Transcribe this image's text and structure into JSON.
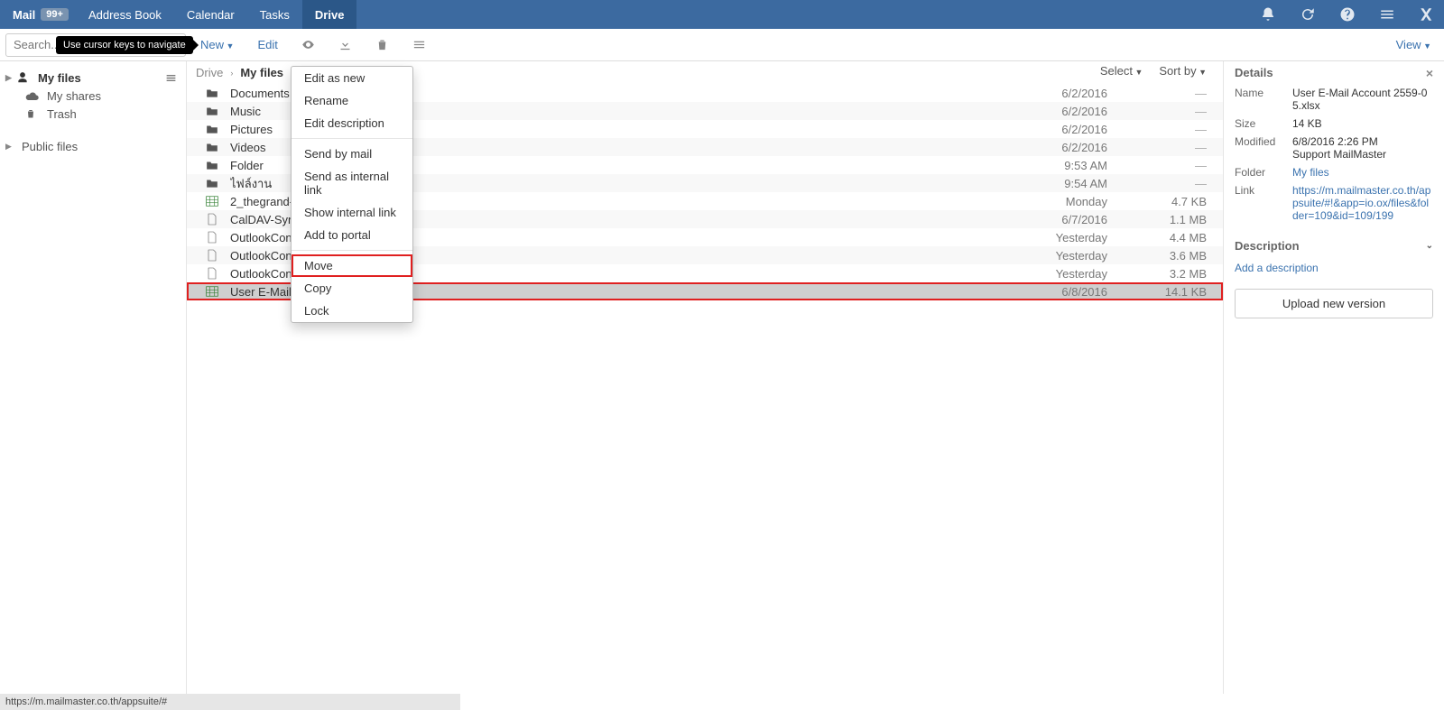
{
  "topnav": {
    "items": [
      {
        "label": "Mail",
        "badge": "99+"
      },
      {
        "label": "Address Book"
      },
      {
        "label": "Calendar"
      },
      {
        "label": "Tasks"
      },
      {
        "label": "Drive",
        "active": true
      }
    ]
  },
  "toolbar": {
    "search_placeholder": "Search...",
    "tooltip": "Use cursor keys to navigate",
    "new_label": "New",
    "edit_label": "Edit",
    "view_label": "View"
  },
  "sidebar": {
    "myfiles": "My files",
    "myshares": "My shares",
    "trash": "Trash",
    "publicfiles": "Public files"
  },
  "breadcrumb": {
    "root": "Drive",
    "current": "My files"
  },
  "listheader": {
    "select": "Select",
    "sortby": "Sort by"
  },
  "contextmenu": {
    "items": [
      "Edit as new",
      "Rename",
      "Edit description",
      "",
      "Send by mail",
      "Send as internal link",
      "Show internal link",
      "Add to portal",
      "",
      "Move",
      "Copy",
      "Lock"
    ],
    "highlight_index": 9
  },
  "files": [
    {
      "icon": "folder",
      "name": "Documents",
      "date": "6/2/2016",
      "size": "—"
    },
    {
      "icon": "folder",
      "name": "Music",
      "date": "6/2/2016",
      "size": "—"
    },
    {
      "icon": "folder",
      "name": "Pictures",
      "date": "6/2/2016",
      "size": "—"
    },
    {
      "icon": "folder",
      "name": "Videos",
      "date": "6/2/2016",
      "size": "—"
    },
    {
      "icon": "folder",
      "name": "Folder",
      "date": "9:53 AM",
      "size": "—"
    },
    {
      "icon": "folder",
      "name": "ไฟล์งาน",
      "date": "9:54 AM",
      "size": "—"
    },
    {
      "icon": "sheet",
      "name": "2_thegrand-ub.c",
      "date": "Monday",
      "size": "4.7 KB"
    },
    {
      "icon": "file",
      "name": "CalDAV-Sync_v",
      "date": "6/7/2016",
      "size": "1.1 MB"
    },
    {
      "icon": "file",
      "name": "OutlookConnec",
      "date": "Yesterday",
      "size": "4.4 MB"
    },
    {
      "icon": "file",
      "name": "OutlookConnec",
      "date": "Yesterday",
      "size": "3.6 MB"
    },
    {
      "icon": "file",
      "name": "OutlookConnec",
      "date": "Yesterday",
      "size": "3.2 MB"
    },
    {
      "icon": "sheet",
      "name": "User E-Mail Account 2559-05.xlsx",
      "date": "6/8/2016",
      "size": "14.1 KB",
      "selected": true,
      "highlight": true
    }
  ],
  "details": {
    "title": "Details",
    "name_label": "Name",
    "name_val": "User E-Mail Account 2559-05.xlsx",
    "size_label": "Size",
    "size_val": "14 KB",
    "modified_label": "Modified",
    "modified_val1": "6/8/2016 2:26 PM",
    "modified_val2": "Support MailMaster",
    "folder_label": "Folder",
    "folder_val": "My files",
    "link_label": "Link",
    "link_val": "https://m.mailmaster.co.th/appsuite/#!&app=io.ox/files&folder=109&id=109/199",
    "description_label": "Description",
    "add_description": "Add a description",
    "upload_btn": "Upload new version"
  },
  "statusbar": "https://m.mailmaster.co.th/appsuite/#"
}
